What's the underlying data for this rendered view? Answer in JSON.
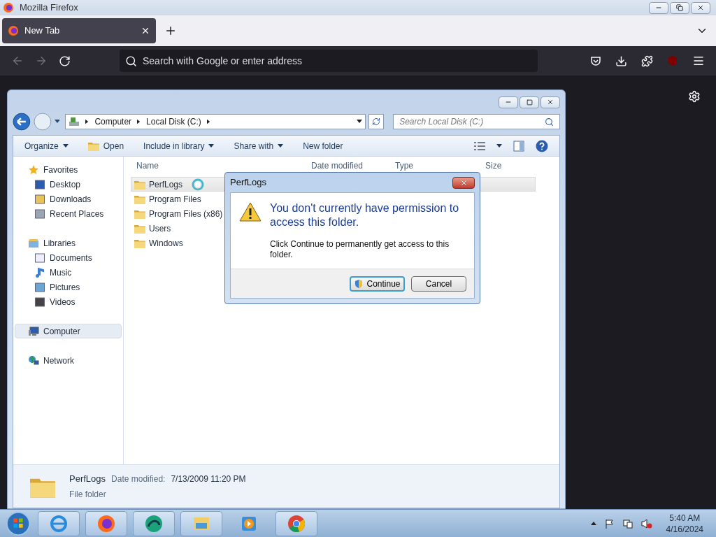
{
  "browser": {
    "title": "Mozilla Firefox",
    "tabs": [
      {
        "label": "New Tab",
        "selected": true
      }
    ],
    "address_placeholder": "Search with Google or enter address"
  },
  "explorer": {
    "breadcrumb": [
      "Computer",
      "Local Disk (C:)"
    ],
    "search_placeholder": "Search Local Disk (C:)",
    "toolbar": [
      {
        "label": "Organize",
        "kind": "menu"
      },
      {
        "label": "Open",
        "kind": "icon"
      },
      {
        "label": "Include in library",
        "kind": "menu"
      },
      {
        "label": "Share with",
        "kind": "menu"
      },
      {
        "label": "New folder",
        "kind": "plain"
      }
    ],
    "sidebar": [
      {
        "label": "Favorites",
        "selected": false,
        "children": [
          {
            "label": "Desktop",
            "selected": false
          },
          {
            "label": "Downloads",
            "selected": false
          },
          {
            "label": "Recent Places",
            "selected": false
          }
        ]
      },
      {
        "label": "Libraries",
        "selected": false,
        "children": [
          {
            "label": "Documents",
            "selected": false
          },
          {
            "label": "Music",
            "selected": false
          },
          {
            "label": "Pictures",
            "selected": false
          },
          {
            "label": "Videos",
            "selected": false
          }
        ]
      },
      {
        "label": "Computer",
        "selected": true
      },
      {
        "label": "Network",
        "selected": false
      }
    ],
    "columns": [
      "Name",
      "Date modified",
      "Type",
      "Size"
    ],
    "files": [
      {
        "name": "PerfLogs",
        "selected": true,
        "busy": true
      },
      {
        "name": "Program Files",
        "selected": false,
        "busy": false
      },
      {
        "name": "Program Files (x86)",
        "selected": false,
        "busy": false
      },
      {
        "name": "Users",
        "selected": false,
        "busy": false
      },
      {
        "name": "Windows",
        "selected": false,
        "busy": false
      }
    ],
    "details": {
      "name": "PerfLogs",
      "date_label": "Date modified:",
      "date": "7/13/2009 11:20 PM",
      "type": "File folder"
    }
  },
  "dialog": {
    "title": "PerfLogs",
    "heading": "You don't currently have permission to access this folder.",
    "message": "Click Continue to permanently get access to this folder.",
    "buttons": [
      {
        "label": "Continue",
        "kind": "shield",
        "focused": true
      },
      {
        "label": "Cancel",
        "kind": "plain",
        "focused": false
      }
    ]
  },
  "taskbar": {
    "time": "5:40 AM",
    "date": "4/16/2024"
  }
}
